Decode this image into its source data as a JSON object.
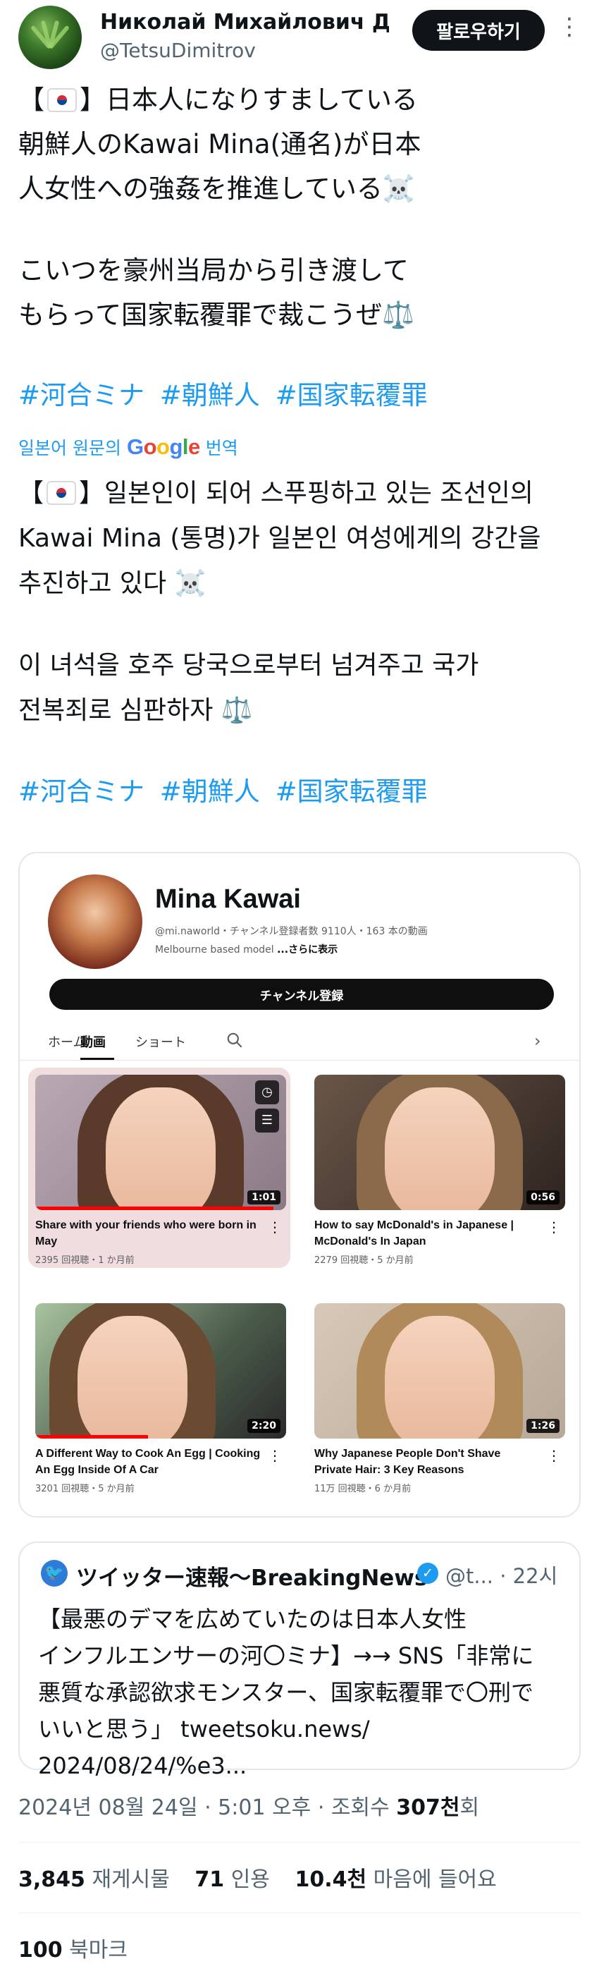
{
  "author": {
    "name": "Николай Михайлович Ди...",
    "handle": "@TetsuDimitrov",
    "follow_label": "팔로우하기"
  },
  "tweet": {
    "jp_paragraph1": [
      "【",
      "】日本人になりすましている",
      "朝鮮人のKawai Mina(通名)が日本",
      "人女性への強姦を推進している☠️"
    ],
    "jp_paragraph2": [
      "こいつを豪州当局から引き渡して",
      "もらって国家転覆罪で裁こうぜ⚖️"
    ],
    "hashtags": [
      "#河合ミナ",
      "#朝鮮人",
      "#国家転覆罪"
    ],
    "translate_prefix": "일본어 원문의",
    "translate_brand": "Google",
    "translate_suffix": "번역",
    "ko_paragraph1": [
      "【",
      "】일본인이 되어 스푸핑하고 있는 조선인의",
      "Kawai Mina (통명)가 일본인 여성에게의 강간을",
      "추진하고 있다 ☠️"
    ],
    "ko_paragraph2": [
      "이 녀석을 호주 당국으로부터 넘겨주고 국가",
      "전복죄로 심판하자 ⚖️"
    ],
    "ko_hashtags": [
      "#河合ミナ",
      "#朝鮮人",
      "#国家転覆罪"
    ]
  },
  "embed": {
    "channel_name": "Mina Kawai",
    "channel_meta": "@mi.naworld・チャンネル登録者数 9110人・163 本の動画",
    "channel_desc": "Melbourne based model",
    "channel_more": "...さらに表示",
    "subscribe_label": "チャンネル登録",
    "tabs": [
      "ホーム",
      "動画",
      "ショート"
    ],
    "videos": [
      {
        "title": "Share with your friends who were born in May",
        "meta": "2395 回視聴・1 か月前",
        "duration": "1:01",
        "progress": 0.95
      },
      {
        "title": "How to say McDonald's in Japanese | McDonald's In Japan",
        "meta": "2279 回視聴・5 か月前",
        "duration": "0:56",
        "progress": 0
      },
      {
        "title": "A Different Way to Cook An Egg | Cooking An Egg Inside Of A Car",
        "meta": "3201 回視聴・5 か月前",
        "duration": "2:20",
        "progress": 0.45
      },
      {
        "title": "Why Japanese People Don't Shave Private Hair: 3 Key Reasons",
        "meta": "11万 回視聴・6 か月前",
        "duration": "1:26",
        "progress": 0
      }
    ]
  },
  "quote": {
    "name": "ツイッター速報〜BreakingNews",
    "handle": "@t... · 22시",
    "lines": [
      "【最悪のデマを広めていたのは日本人女性",
      "インフルエンサーの河〇ミナ】→→ SNS「非常に",
      "悪質な承認欲求モンスター、国家転覆罪で〇刑で",
      "いいと思う」 tweetsoku.news/",
      "2024/08/24/%e3..."
    ]
  },
  "meta": {
    "timestamp": "2024년 08월 24일 · 5:01 오후 · 조회수",
    "views": "307천",
    "views_suffix": "회"
  },
  "stats": {
    "retweets": "3,845",
    "retweets_label": "재게시물",
    "quotes": "71",
    "quotes_label": "인용",
    "likes": "10.4천",
    "likes_label": "마음에 들어요",
    "bookmarks": "100",
    "bookmarks_label": "북마크"
  },
  "colors": {
    "link": "#1d9bf0",
    "text": "#0f1419",
    "secondary": "#536471",
    "yt_red": "#ff0000"
  }
}
